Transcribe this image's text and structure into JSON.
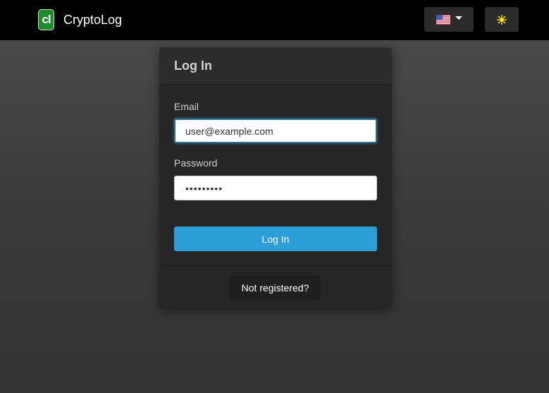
{
  "navbar": {
    "brand_logo_text": "cl",
    "brand_name": "CryptoLog",
    "language_icon": "us-flag-icon",
    "theme_icon": "sun-icon"
  },
  "login_card": {
    "title": "Log In",
    "email_label": "Email",
    "email_value": "user@example.com",
    "password_label": "Password",
    "password_value": "•••••••••",
    "login_button": "Log In",
    "register_button": "Not registered?"
  },
  "colors": {
    "navbar_bg": "#000000",
    "logo_green": "#1a8c2a",
    "primary_button": "#2c9fd8",
    "theme_icon": "#ffe600"
  }
}
